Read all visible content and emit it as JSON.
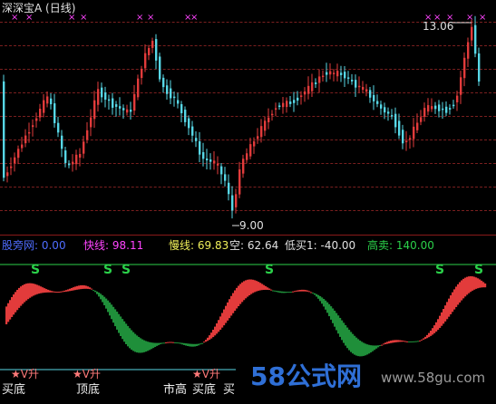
{
  "top_title": "深深宝A (日线)",
  "price_annotations": {
    "high": "13.06",
    "low": "9.00"
  },
  "indicator_bar": {
    "name_label": "股旁网: 0.00",
    "fast_label": "快线: 98.11",
    "slow_label": "慢线: 69.83",
    "empty_label": "空: 62.64",
    "low_buy_label": "低买1: -40.00",
    "high_sell_label": "高卖: 140.00"
  },
  "signal_texts": [
    "买底",
    "顶底",
    "市高",
    "买底",
    "买"
  ],
  "star_texts": [
    "★V升",
    "★V升",
    "★V升"
  ],
  "watermark": {
    "text": "58公式网",
    "url": "www.58gu.com"
  },
  "colors": {
    "up": "#e23b3b",
    "down": "#57d7e6",
    "grid": "#7a1f1f",
    "magenta": "#ff44ff",
    "green": "#2bd14a",
    "label_blue": "#4f6dff",
    "label_yellow": "#f0f05a",
    "label_white": "#e0e0e0",
    "label_green": "#2bd14a"
  }
}
